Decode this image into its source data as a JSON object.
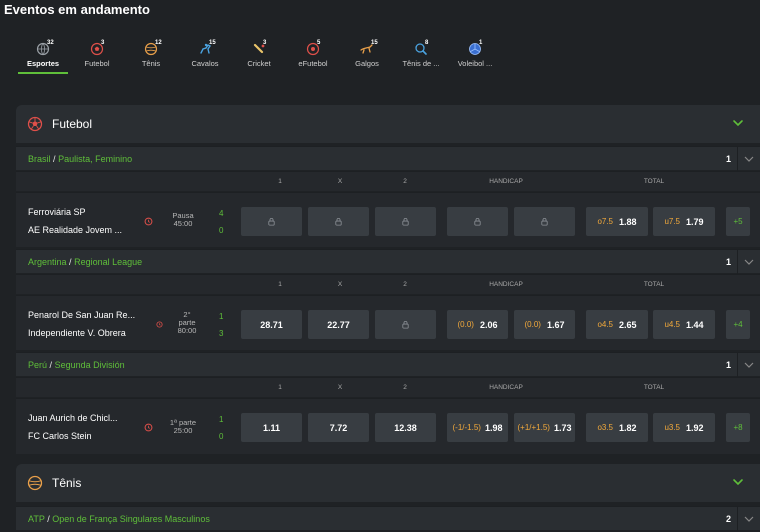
{
  "page_title": "Eventos em andamento",
  "sports_nav": [
    {
      "label": "Esportes",
      "count": "32",
      "icon": "globe-icon",
      "active": true
    },
    {
      "label": "Futebol",
      "count": "3",
      "icon": "soccer-ball-icon"
    },
    {
      "label": "Tênis",
      "count": "12",
      "icon": "tennis-ball-icon"
    },
    {
      "label": "Cavalos",
      "count": "15",
      "icon": "horse-rider-icon"
    },
    {
      "label": "Cricket",
      "count": "3",
      "icon": "cricket-bat-icon"
    },
    {
      "label": "eFutebol",
      "count": "5",
      "icon": "esoccer-ball-icon"
    },
    {
      "label": "Galgos",
      "count": "15",
      "icon": "greyhound-icon"
    },
    {
      "label": "Tênis de ...",
      "count": "8",
      "icon": "table-tennis-icon"
    },
    {
      "label": "Voleibol ...",
      "count": "1",
      "icon": "volleyball-icon"
    }
  ],
  "sections": {
    "futebol": {
      "title": "Futebol",
      "icon": "soccer-ball-icon"
    },
    "tenis": {
      "title": "Tênis",
      "icon": "tennis-ball-icon"
    }
  },
  "columns": {
    "c1": "1",
    "cx": "X",
    "c2": "2",
    "handicap": "HANDICAP",
    "total": "TOTAL"
  },
  "leagues": [
    {
      "country": "Brasil",
      "name": "Paulista, Feminino",
      "count": "1",
      "match": {
        "home": "Ferroviária SP",
        "away": "AE Realidade Jovem ...",
        "status": [
          "Pausa",
          "45:00"
        ],
        "score_home": "4",
        "score_away": "0",
        "odds_1x2": [
          "",
          "",
          ""
        ],
        "handicap": [
          {
            "line": "",
            "odd": ""
          },
          {
            "line": "",
            "odd": ""
          }
        ],
        "total": [
          {
            "line": "o7.5",
            "odd": "1.88"
          },
          {
            "line": "u7.5",
            "odd": "1.79"
          }
        ],
        "more": "+5"
      }
    },
    {
      "country": "Argentina",
      "name": "Regional League",
      "count": "1",
      "match": {
        "home": "Penarol De San Juan Re...",
        "away": "Independiente V. Obrera",
        "status": [
          "2°",
          "parte",
          "80:00"
        ],
        "score_home": "1",
        "score_away": "3",
        "odds_1x2": [
          "28.71",
          "22.77",
          ""
        ],
        "handicap": [
          {
            "line": "(0.0)",
            "odd": "2.06"
          },
          {
            "line": "(0.0)",
            "odd": "1.67"
          }
        ],
        "total": [
          {
            "line": "o4.5",
            "odd": "2.65"
          },
          {
            "line": "u4.5",
            "odd": "1.44"
          }
        ],
        "more": "+4"
      }
    },
    {
      "country": "Perú",
      "name": "Segunda División",
      "count": "1",
      "match": {
        "home": "Juan Aurich de Chicl...",
        "away": "FC Carlos Stein",
        "status": [
          "1ª parte",
          "25:00"
        ],
        "score_home": "1",
        "score_away": "0",
        "odds_1x2": [
          "1.11",
          "7.72",
          "12.38"
        ],
        "handicap": [
          {
            "line": "(-1/-1.5)",
            "odd": "1.98"
          },
          {
            "line": "(+1/+1.5)",
            "odd": "1.73"
          }
        ],
        "total": [
          {
            "line": "o3.5",
            "odd": "1.82"
          },
          {
            "line": "u3.5",
            "odd": "1.92"
          }
        ],
        "more": "+8"
      }
    },
    {
      "country": "ATP",
      "name": "Open de França Singulares Masculinos",
      "count": "2"
    }
  ],
  "colors": {
    "accent": "#5fbf3a",
    "handicap_line": "#f2a93b",
    "clock_red": "#e0504a",
    "bg": "#1f2225"
  }
}
